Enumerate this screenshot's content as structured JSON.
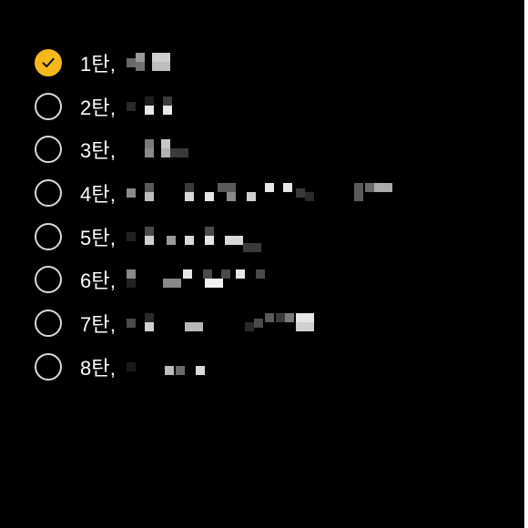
{
  "accent_color": "#f6b81b",
  "checklist": {
    "items": [
      {
        "label": "1탄,",
        "checked": true,
        "icon": "checkmark-icon"
      },
      {
        "label": "2탄,",
        "checked": false,
        "icon": "empty-circle-icon"
      },
      {
        "label": "3탄,",
        "checked": false,
        "icon": "empty-circle-icon"
      },
      {
        "label": "4탄,",
        "checked": false,
        "icon": "empty-circle-icon"
      },
      {
        "label": "5탄,",
        "checked": false,
        "icon": "empty-circle-icon"
      },
      {
        "label": "6탄,",
        "checked": false,
        "icon": "empty-circle-icon"
      },
      {
        "label": "7탄,",
        "checked": false,
        "icon": "empty-circle-icon"
      },
      {
        "label": "8탄,",
        "checked": false,
        "icon": "empty-circle-icon"
      }
    ]
  }
}
